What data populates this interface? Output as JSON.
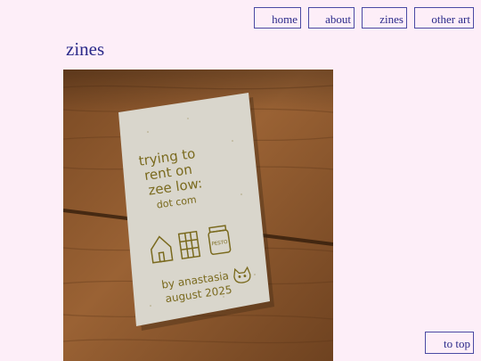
{
  "nav": {
    "home": "home",
    "about": "about",
    "zines": "zines",
    "other_art": "other art"
  },
  "page": {
    "title": "zines"
  },
  "zine": {
    "line1": "trying to",
    "line2": "rent on",
    "line3": "zee low:",
    "line4": "dot com",
    "jar_label": "PESTO",
    "author": "by anastasia",
    "date": "august 2025"
  },
  "footer": {
    "to_top": "to top"
  },
  "colors": {
    "background": "#fdeef8",
    "text": "#2b2a8a",
    "border": "#4b4aa3",
    "ink": "#7a6a1e"
  }
}
